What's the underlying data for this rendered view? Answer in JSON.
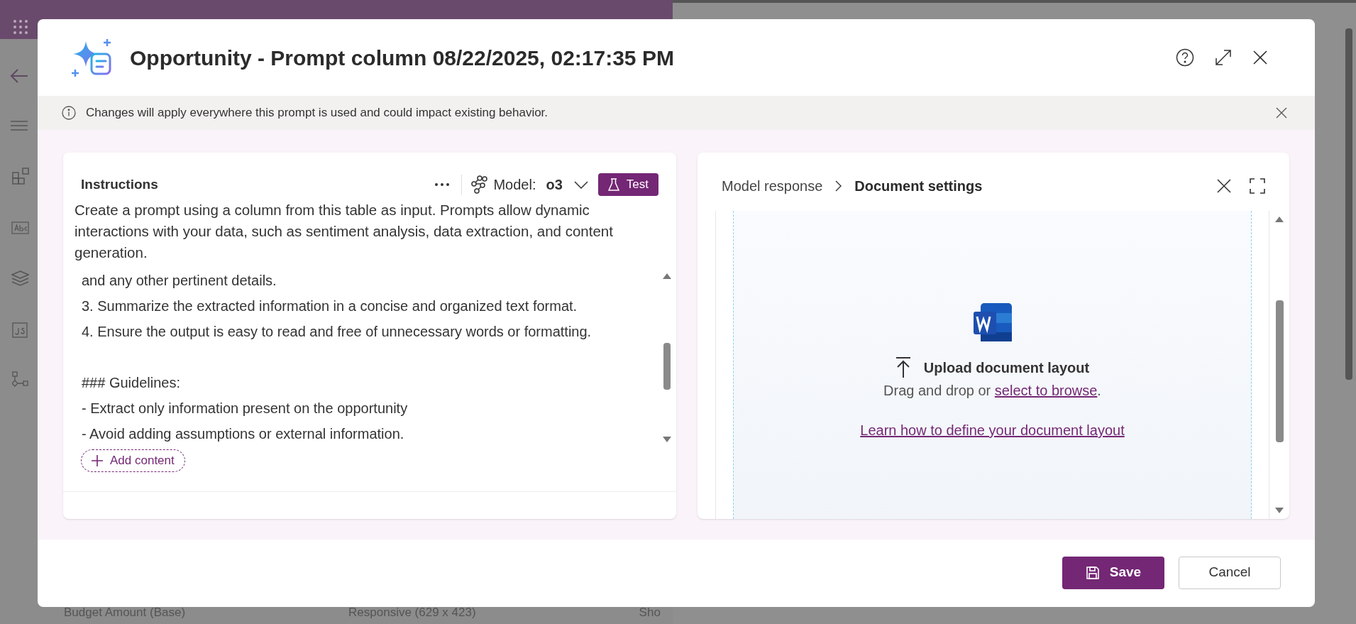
{
  "app": {
    "bottom_texts": [
      "Budget Amount (Base)",
      "Responsive (629 x 423)",
      "Sho"
    ]
  },
  "dialog": {
    "title": "Opportunity - Prompt column 08/22/2025, 02:17:35 PM",
    "info": "Changes will apply everywhere this prompt is used and could impact existing behavior.",
    "instructions": {
      "title": "Instructions",
      "model_label": "Model:",
      "model_value": "o3",
      "test_button": "Test",
      "intro": "Create a prompt using a column from this table as input. Prompts allow dynamic interactions with your data, such as sentiment analysis, data extraction, and content generation.",
      "lines": [
        {
          "kind": "text",
          "text": "and any other pertinent details."
        },
        {
          "kind": "text",
          "text": "3. Summarize the extracted information in a concise and organized text format."
        },
        {
          "kind": "text",
          "text": "4. Ensure the output is easy to read and free of unnecessary words or formatting."
        },
        {
          "kind": "blank"
        },
        {
          "kind": "text",
          "text": "### Guidelines:"
        },
        {
          "kind": "text",
          "text": "- Extract only information present on the opportunity"
        },
        {
          "kind": "text",
          "text": "- Avoid adding assumptions or external information."
        }
      ],
      "add_content": "Add content"
    },
    "response": {
      "breadcrumb": [
        {
          "label": "Model response",
          "selected": false
        },
        {
          "label": "Document settings",
          "selected": true
        }
      ],
      "upload_title": "Upload document layout",
      "drag_text": "Drag and drop or ",
      "browse_link": "select to browse",
      "drag_end": ".",
      "learn_link": "Learn how to define your document layout"
    },
    "buttons": [
      {
        "label": "Save",
        "kind": "primary"
      },
      {
        "label": "Cancel",
        "kind": "secondary"
      }
    ]
  }
}
